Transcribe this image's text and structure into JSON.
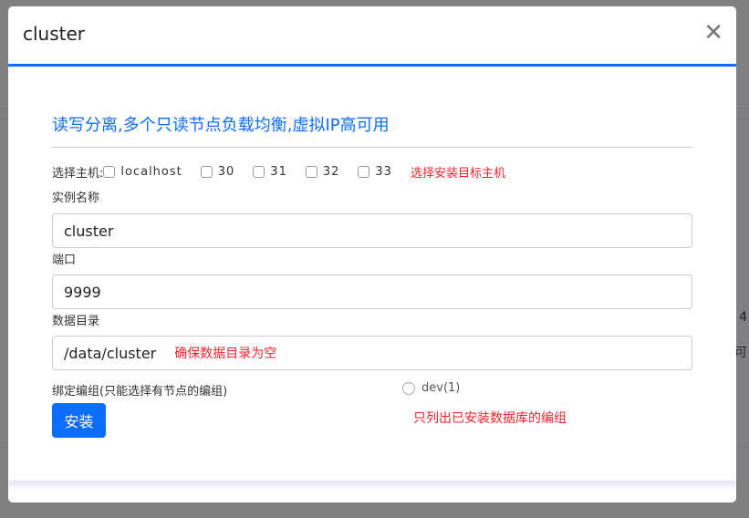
{
  "background": {
    "right_text_1": "4",
    "right_text_2": "可"
  },
  "modal": {
    "title": "cluster",
    "close_icon": "close-icon",
    "intro": "读写分离,多个只读节点负载均衡,虚拟IP高可用",
    "hosts": {
      "label": "选择主机:",
      "options": [
        {
          "label": "localhost",
          "checked": false
        },
        {
          "label": "30",
          "checked": false
        },
        {
          "label": "31",
          "checked": false
        },
        {
          "label": "32",
          "checked": false
        },
        {
          "label": "33",
          "checked": false
        }
      ],
      "hint": "选择安装目标主机"
    },
    "instance": {
      "label": "实例名称",
      "value": "cluster"
    },
    "port": {
      "label": "端口",
      "value": "9999"
    },
    "datadir": {
      "label": "数据目录",
      "value": "/data/cluster",
      "hint": "确保数据目录为空"
    },
    "group": {
      "label": "绑定编组(只能选择有节点的编组)",
      "option": "dev(1)",
      "selected": false,
      "hint": "只列出已安装数据库的编组"
    },
    "install_button": "安装",
    "accent": "#0d6efd",
    "warn": "#f5222d"
  }
}
